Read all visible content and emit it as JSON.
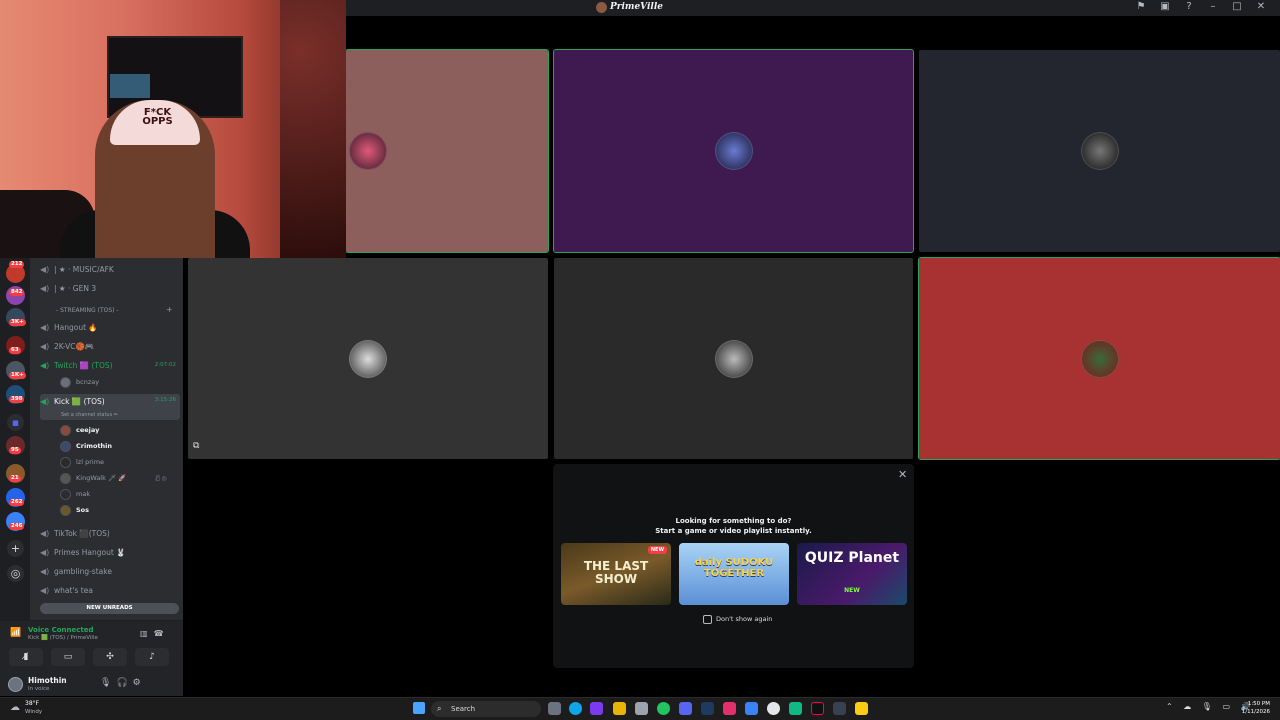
{
  "window": {
    "title": "PrimeVille"
  },
  "webcam": {
    "hat_text": "F*CK OPPS"
  },
  "server_rail": {
    "badges": [
      "212",
      "842",
      "3K+",
      "63",
      "1K+",
      "398",
      "95",
      "21",
      "262",
      "246"
    ]
  },
  "channels": {
    "music_afk": "| ★ · MUSIC/AFK",
    "gen3": "| ★ · GEN 3",
    "streaming_category": "- STREAMING (TOS) -",
    "hangout": "Hangout 🔥",
    "twok_vc": "2K-VC🏀🎮",
    "twitch": "Twitch 🟪 (TOS)",
    "twitch_timer": "2:07:02",
    "twitch_user": "bcnzay",
    "kick": "Kick 🟩 (TOS)",
    "kick_timer": "3:15:26",
    "kick_status": "Set a channel status ✏",
    "kick_users": [
      "ceejay",
      "Crimothin",
      "lzl prime",
      "KingWalk 🗡 🚀",
      "mak",
      "Sos"
    ],
    "tiktok": "TikTok ⬛(TOS)",
    "primes_hangout": "Primes Hangout 🐰",
    "gambling": "gambling-stake",
    "whats_tea": "what's tea",
    "new_unreads": "NEW UNREADS"
  },
  "voice": {
    "title": "Voice Connected",
    "subtitle": "Kick 🟩 (TOS) / PrimeVille"
  },
  "user_panel": {
    "name": "Himothin",
    "status": "In voice"
  },
  "activity": {
    "line1": "Looking for something to do?",
    "line2": "Start a game or video playlist instantly.",
    "card1": "THE LAST SHOW",
    "card1_new": "NEW",
    "card2": "daily SUDOKU TOGETHER",
    "card3": "QUIZ Planet",
    "card3_new": "NEW",
    "dont_show": "Don't show again"
  },
  "taskbar": {
    "weather_temp": "38°F",
    "weather_desc": "Windy",
    "search": "Search",
    "time": "1:50 PM",
    "date": "1/11/2026"
  },
  "colors": {
    "speaking": "#23a55a",
    "tile_rose": "#8c5f5c",
    "tile_purple": "#3f1a50",
    "tile_navy": "#23262f",
    "tile_gray": "#333333",
    "tile_dark": "#2a2a2a",
    "tile_red": "#a83232"
  }
}
